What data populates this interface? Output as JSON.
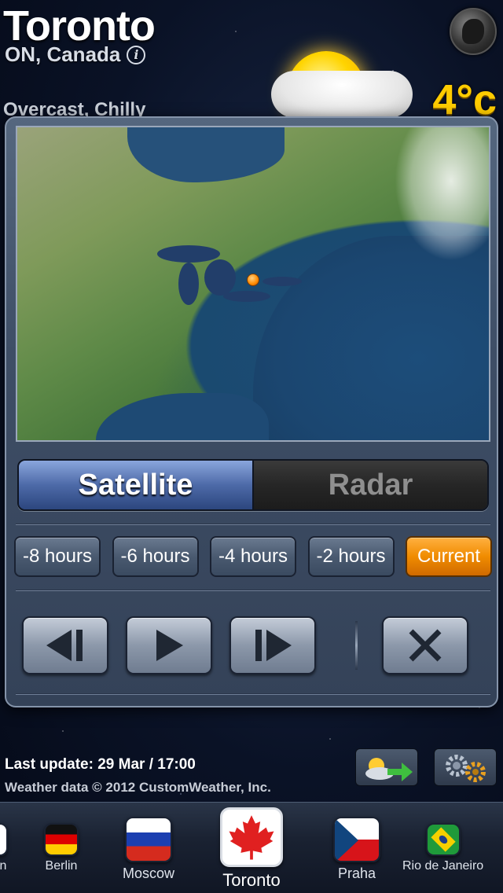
{
  "header": {
    "city": "Toronto",
    "region": "ON, Canada",
    "info_icon": "i",
    "condition": "Overcast, Chilly",
    "temperature": "4°c"
  },
  "radar_panel": {
    "map_view": "satellite-map",
    "segments": [
      {
        "label": "Satellite",
        "selected": true
      },
      {
        "label": "Radar",
        "selected": false
      }
    ],
    "hours": [
      {
        "label": "-8 hours",
        "active": false
      },
      {
        "label": "-6 hours",
        "active": false
      },
      {
        "label": "-4 hours",
        "active": false
      },
      {
        "label": "-2 hours",
        "active": false
      },
      {
        "label": "Current",
        "active": true
      }
    ],
    "controls": [
      "step-back-icon",
      "play-icon",
      "step-forward-icon",
      "close-icon"
    ]
  },
  "footer": {
    "last_update": "Last update: 29 Mar / 17:00",
    "copyright": "Weather data © 2012 CustomWeather, Inc.",
    "buttons": [
      "weather-share-icon",
      "gear-icon"
    ]
  },
  "cities": [
    {
      "name": "n"
    },
    {
      "name": "Berlin"
    },
    {
      "name": "Moscow"
    },
    {
      "name": "Toronto",
      "selected": true
    },
    {
      "name": "Praha"
    },
    {
      "name": "Rio de Janeiro"
    }
  ],
  "colors": {
    "accent": "#f08c00",
    "segment_active": "#4d6aa8",
    "temperature": "#ffcc00"
  }
}
